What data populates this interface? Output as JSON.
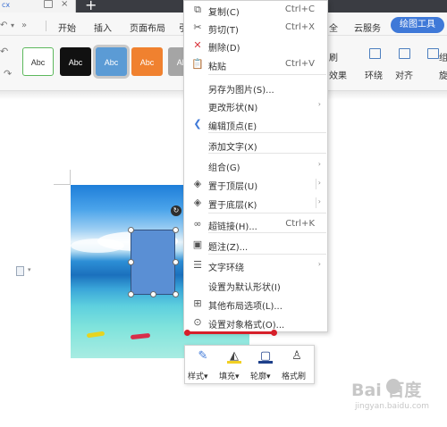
{
  "titlebar": {
    "doc_tab": "cx",
    "close_glyph": "×",
    "new_tab_glyph": "+"
  },
  "menubar": {
    "undo_glyph": "↶",
    "dropdown_glyph": "▾",
    "tabs": [
      "开始",
      "插入",
      "页面布局",
      "引",
      "全",
      "云服务"
    ],
    "active_tab": "绘图工具"
  },
  "ribbon": {
    "styles": [
      {
        "label": "Abc",
        "bg": "#ffffff",
        "fg": "#333333",
        "border": "#5cb85c"
      },
      {
        "label": "Abc",
        "bg": "#111111",
        "fg": "#ffffff",
        "border": "#111111"
      },
      {
        "label": "Abc",
        "bg": "#5b9bd5",
        "fg": "#ffffff",
        "border": "#5b9bd5"
      },
      {
        "label": "Abc",
        "bg": "#f0812f",
        "fg": "#ffffff",
        "border": "#f0812f"
      },
      {
        "label": "Abc",
        "bg": "#a5a5a5",
        "fg": "#ffffff",
        "border": "#a5a5a5"
      }
    ],
    "right": {
      "brush": "刷",
      "effects": "效果",
      "wrap": "环绕",
      "align": "对齐",
      "combine": "组",
      "rotate": "旋"
    }
  },
  "context_menu": {
    "items": [
      {
        "id": "copy",
        "icon": "copy-icon",
        "glyph": "⧉",
        "label": "复制(C)",
        "shortcut": "Ctrl+C"
      },
      {
        "id": "cut",
        "icon": "scissors-icon",
        "glyph": "✂",
        "label": "剪切(T)",
        "shortcut": "Ctrl+X"
      },
      {
        "id": "delete",
        "icon": "delete-icon",
        "glyph": "✕",
        "label": "删除(D)",
        "shortcut": ""
      },
      {
        "id": "paste",
        "icon": "paste-icon",
        "glyph": "📋",
        "label": "粘贴",
        "shortcut": "Ctrl+V"
      },
      {
        "id": "save-as-picture",
        "icon": "",
        "glyph": "",
        "label": "另存为图片(S)...",
        "shortcut": ""
      },
      {
        "id": "change-shape",
        "icon": "",
        "glyph": "",
        "label": "更改形状(N)",
        "shortcut": ""
      },
      {
        "id": "edit-points",
        "icon": "edit-points-icon",
        "glyph": "❮",
        "label": "编辑顶点(E)",
        "shortcut": ""
      },
      {
        "id": "add-text",
        "icon": "",
        "glyph": "",
        "label": "添加文字(X)",
        "shortcut": ""
      },
      {
        "id": "group",
        "icon": "",
        "glyph": "",
        "label": "组合(G)",
        "shortcut": ""
      },
      {
        "id": "bring-to-front",
        "icon": "layers-front-icon",
        "glyph": "◈",
        "label": "置于顶层(U)",
        "shortcut": ""
      },
      {
        "id": "send-to-back",
        "icon": "layers-back-icon",
        "glyph": "◈",
        "label": "置于底层(K)",
        "shortcut": ""
      },
      {
        "id": "hyperlink",
        "icon": "link-icon",
        "glyph": "∞",
        "label": "超链接(H)...",
        "shortcut": "Ctrl+K"
      },
      {
        "id": "caption",
        "icon": "caption-icon",
        "glyph": "▣",
        "label": "题注(Z)...",
        "shortcut": ""
      },
      {
        "id": "text-wrap",
        "icon": "text-wrap-icon",
        "glyph": "☰",
        "label": "文字环绕",
        "shortcut": ""
      },
      {
        "id": "set-default-shape",
        "icon": "",
        "glyph": "",
        "label": "设置为默认形状(I)",
        "shortcut": ""
      },
      {
        "id": "more-layout",
        "icon": "layout-icon",
        "glyph": "⊞",
        "label": "其他布局选项(L)...",
        "shortcut": ""
      },
      {
        "id": "format-object",
        "icon": "format-object-icon",
        "glyph": "⊙",
        "label": "设置对象格式(O)...",
        "shortcut": ""
      }
    ],
    "submenu_arrow": "›"
  },
  "mini_toolbar": {
    "tools": [
      {
        "id": "style",
        "icon": "brush-icon",
        "glyph": "✎",
        "label": "样式"
      },
      {
        "id": "fill",
        "icon": "fill-bucket-icon",
        "glyph": "◭",
        "label": "填充"
      },
      {
        "id": "outline",
        "icon": "outline-icon",
        "glyph": "▢",
        "label": "轮廓"
      },
      {
        "id": "format-painter",
        "icon": "format-painter-icon",
        "glyph": "♙",
        "label": "格式刷"
      }
    ],
    "dropdown_glyph": "▾"
  },
  "canvas": {
    "rotate_glyph": "↻"
  },
  "watermark": {
    "logo": "Bai  百度",
    "url": "jingyan.baidu.com"
  }
}
